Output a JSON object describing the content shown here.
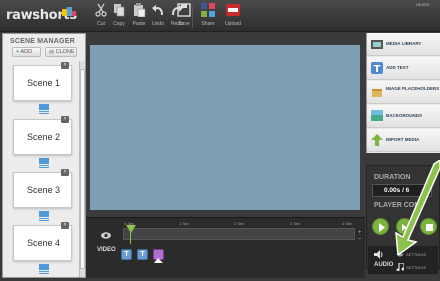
{
  "app": {
    "logo": "rawshorts",
    "corner_text": "HEADE"
  },
  "toolbar": {
    "cut": "Cut",
    "copy": "Copy",
    "paste": "Paste",
    "undo": "Undo",
    "redo": "Redo",
    "save": "Save",
    "share": "Share",
    "upload": "Upload"
  },
  "scene_manager": {
    "title": "SCENE MANAGER",
    "add": "ADD",
    "clone": "CLONE",
    "scenes": [
      "Scene 1",
      "Scene 2",
      "Scene 3",
      "Scene 4"
    ],
    "fx_label": "FX"
  },
  "timeline": {
    "ticks": [
      "0 Sec",
      "1 Sec",
      "2 Sec",
      "3 Sec",
      "4 Sec"
    ],
    "video_label": "VIDEO",
    "text_button": "T",
    "text2_button": "T"
  },
  "right_menu": {
    "items": [
      "MEDIA LIBRARY",
      "ADD TEXT",
      "IMAGE PLACEHOLDERS",
      "BACKGROUNDS",
      "IMPORT MEDIA"
    ]
  },
  "duration": {
    "title": "DURATION",
    "value": "0.00s / 6"
  },
  "player": {
    "title": "PLAYER CONT"
  },
  "audio": {
    "label": "AUDIO",
    "settings1": "SETTINGS",
    "settings2": "SETTINGS"
  },
  "colors": {
    "accent": "#7cb342",
    "stage": "#7d9fb3",
    "dark": "#2b2b2b"
  }
}
